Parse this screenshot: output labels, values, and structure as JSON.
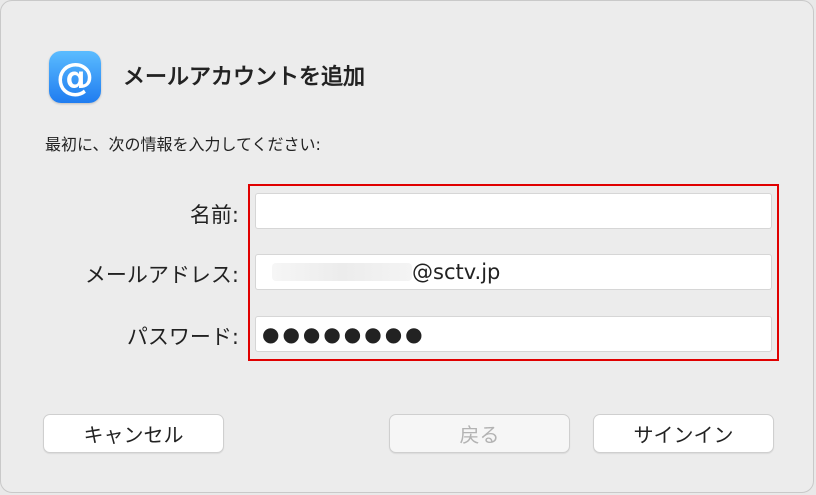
{
  "dialog": {
    "title": "メールアカウントを追加",
    "intro": "最初に、次の情報を入力してください:",
    "app_icon_glyph": "@"
  },
  "form": {
    "name": {
      "label": "名前:",
      "value": ""
    },
    "email": {
      "label": "メールアドレス:",
      "domain": "@sctv.jp"
    },
    "password": {
      "label": "パスワード:",
      "value": "●●●●●●●●"
    }
  },
  "buttons": {
    "cancel": "キャンセル",
    "back": "戻る",
    "sign_in": "サインイン"
  },
  "colors": {
    "highlight_border": "#e00000",
    "icon_blue": "#1f7cf0"
  }
}
